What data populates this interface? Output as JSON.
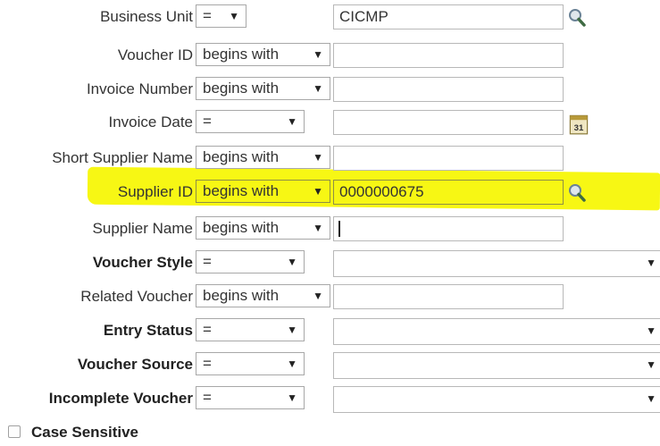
{
  "rows": [
    {
      "label": "Business Unit",
      "bold": false,
      "operator": "=",
      "value": "CICMP",
      "icon": "magnifier-icon"
    },
    {
      "label": "Voucher ID",
      "bold": false,
      "operator": "begins with",
      "value": ""
    },
    {
      "label": "Invoice Number",
      "bold": false,
      "operator": "begins with",
      "value": ""
    },
    {
      "label": "Invoice Date",
      "bold": false,
      "operator": "=",
      "value": "",
      "icon": "calendar-icon",
      "calendar_text": "31"
    },
    {
      "label": "Short Supplier Name",
      "bold": false,
      "operator": "begins with",
      "value": ""
    },
    {
      "label": "Supplier ID",
      "bold": false,
      "operator": "begins with",
      "value": "0000000675",
      "icon": "magnifier-icon",
      "highlighted": true
    },
    {
      "label": "Supplier Name",
      "bold": false,
      "operator": "begins with",
      "value": ""
    },
    {
      "label": "Voucher Style",
      "bold": true,
      "operator": "=",
      "value": ""
    },
    {
      "label": "Related Voucher",
      "bold": false,
      "operator": "begins with",
      "value": ""
    },
    {
      "label": "Entry Status",
      "bold": true,
      "operator": "=",
      "value": ""
    },
    {
      "label": "Voucher Source",
      "bold": true,
      "operator": "=",
      "value": ""
    },
    {
      "label": "Incomplete Voucher",
      "bold": true,
      "operator": "=",
      "value": ""
    }
  ],
  "dropdown_arrow": "▼",
  "case_sensitive": {
    "label": "Case Sensitive",
    "checked": false
  },
  "colors": {
    "highlight": "#f7f714",
    "border": "#a8a8a8",
    "text": "#333333"
  }
}
